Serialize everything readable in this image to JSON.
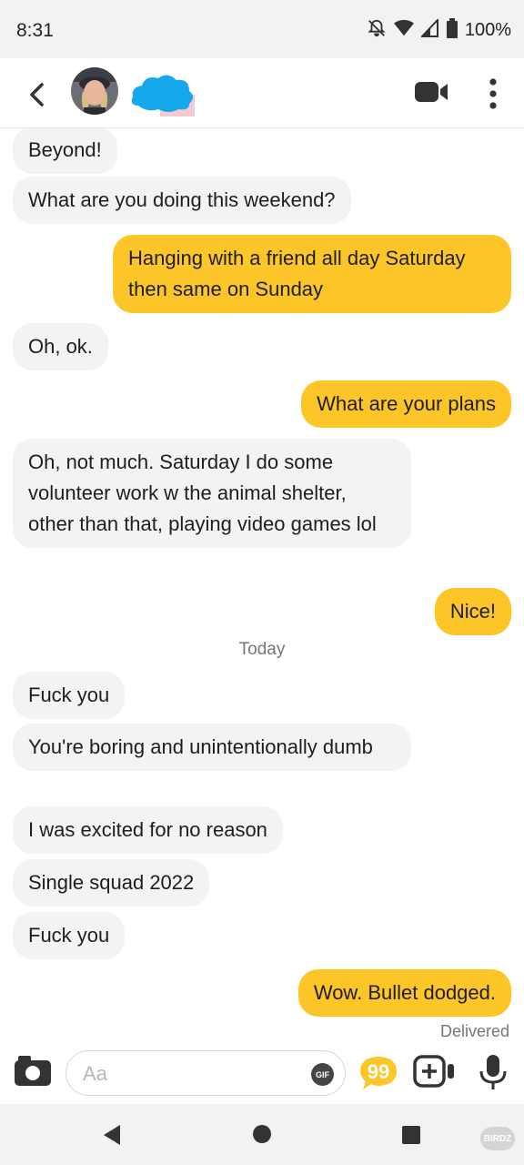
{
  "status_bar": {
    "time": "8:31",
    "battery": "100%"
  },
  "header": {
    "avatar": "profile-photo"
  },
  "messages": [
    {
      "dir": "in",
      "text": "Beyond!"
    },
    {
      "dir": "in",
      "text": "What are you doing this weekend?"
    },
    {
      "dir": "out",
      "text": "Hanging with a friend all day Saturday then same on Sunday"
    },
    {
      "dir": "in",
      "text": "Oh, ok."
    },
    {
      "dir": "out",
      "text": "What are your plans"
    },
    {
      "dir": "in",
      "text": "Oh, not much. Saturday I do some volunteer work w the animal shelter, other than that, playing video games lol"
    },
    {
      "dir": "out",
      "text": "Nice!"
    },
    {
      "dir": "in",
      "text": "Fuck you"
    },
    {
      "dir": "in",
      "text": "You're boring and unintentionally dumb"
    },
    {
      "dir": "in",
      "text": "I was excited for no reason"
    },
    {
      "dir": "in",
      "text": "Single squad 2022"
    },
    {
      "dir": "in",
      "text": "Fuck you"
    },
    {
      "dir": "out",
      "text": "Wow.  Bullet dodged."
    }
  ],
  "day_separator": "Today",
  "delivered_label": "Delivered",
  "composer": {
    "placeholder": "Aa",
    "gif_label": "GIF"
  },
  "watermark": "BIRDZ",
  "colors": {
    "outgoing_bubble": "#fcc528",
    "incoming_bubble": "#f3f3f3",
    "accent": "#fcc528"
  },
  "icons": {
    "header": [
      "back-arrow-icon",
      "video-call-icon",
      "more-vertical-icon"
    ],
    "composer": [
      "camera-icon",
      "gif-icon",
      "quote-icon",
      "add-media-icon",
      "microphone-icon"
    ],
    "nav": [
      "nav-back-icon",
      "nav-home-icon",
      "nav-recents-icon"
    ]
  }
}
